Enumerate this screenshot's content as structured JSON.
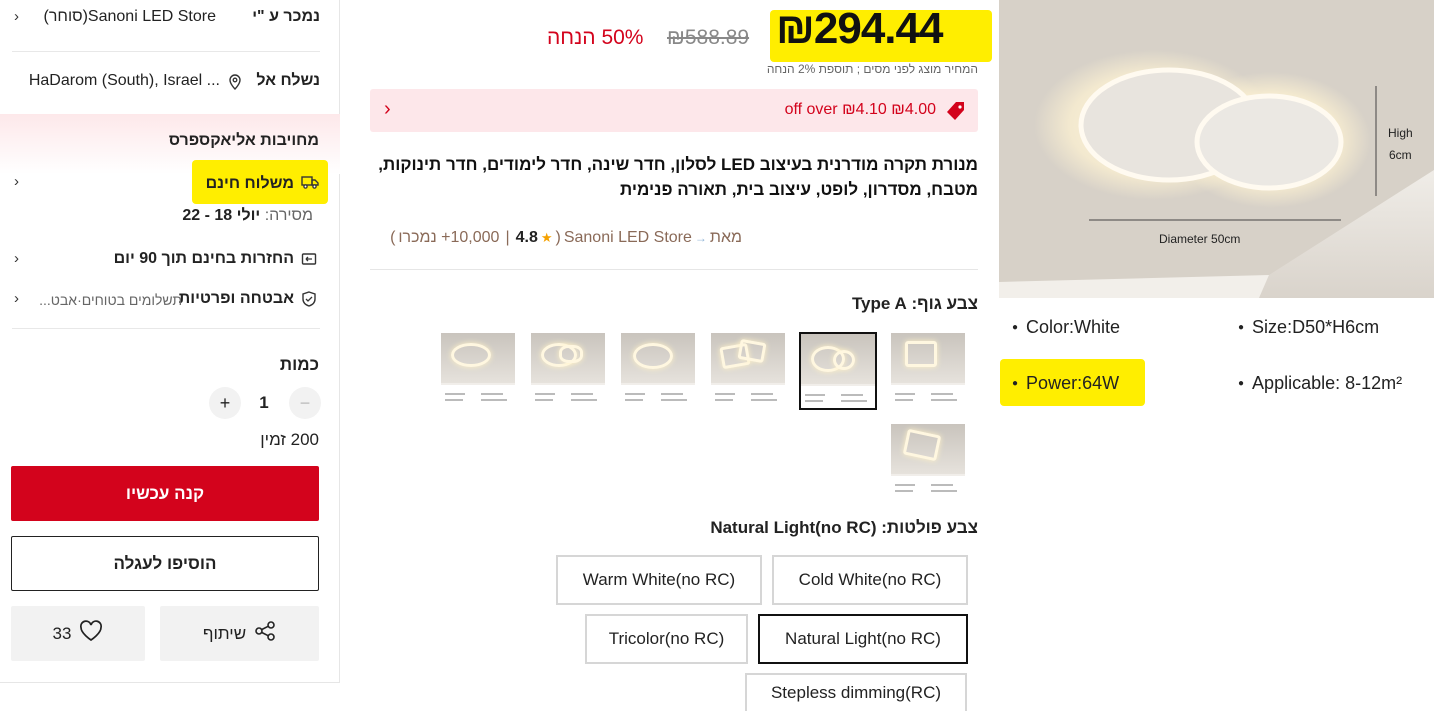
{
  "seller": {
    "sold_by_label": "נמכר ע \"י",
    "store_name": "Sanoni LED Store(סוחר)"
  },
  "shipping": {
    "ship_to_label": "נשלח אל",
    "location": "HaDarom (South), Israel ..."
  },
  "commitments": {
    "title": "מחויבות אליאקספרס",
    "free_shipping": "משלוח חינם",
    "delivery_label": "מסירה:",
    "delivery_dates": "יולי 18 - 22",
    "free_returns": "החזרות בחינם תוך 90 יום",
    "security_title": "אבטחה ופרטיות",
    "security_sub": "תשלומים בטוחים·אבט..."
  },
  "quantity": {
    "label": "כמות",
    "value": "1",
    "available": "200 זמין"
  },
  "actions": {
    "buy_now": "קנה עכשיו",
    "add_to_cart": "הוסיפו לעגלה",
    "share": "שיתוף",
    "wishlist_count": "33"
  },
  "price": {
    "current": "₪294.44",
    "original": "₪588.89",
    "discount": "50% הנחה",
    "tax_note": "המחיר מוצג לפני מסים ; תוספת 2% הנחה",
    "coupon": "₪4.00 off over ₪4.10"
  },
  "product": {
    "title": "מנורת תקרה מודרנית בעיצוב LED לסלון, חדר שינה, חדר לימודים, חדר תינוקות, מטבח, מסדרון, לופט, עיצוב בית, תאורה פנימית",
    "by_label": "מאת",
    "store": "Sanoni LED Store",
    "rating": "4.8",
    "sold": "10,000+ נמכרו"
  },
  "body_color": {
    "label": "צבע גוף:",
    "value": "Type A"
  },
  "light_color": {
    "label": "צבע פולטות:",
    "value": "Natural Light(no RC)",
    "options": [
      "Warm White(no RC)",
      "Cold White(no RC)",
      "Tricolor(no RC)",
      "Natural Light(no RC)",
      "Stepless dimming(RC)"
    ]
  },
  "hero_image": {
    "diameter_label": "Diameter 50cm",
    "height_label": "High\n6cm",
    "specs": {
      "color": "Color:White",
      "size": "Size:D50*H6cm",
      "power": "Power:64W",
      "applicable": "Applicable: 8-12m²"
    }
  },
  "colors": {
    "accent_red": "#d3031c",
    "highlight_yellow": "#ffee00",
    "coupon_bg": "#fde7ea"
  }
}
